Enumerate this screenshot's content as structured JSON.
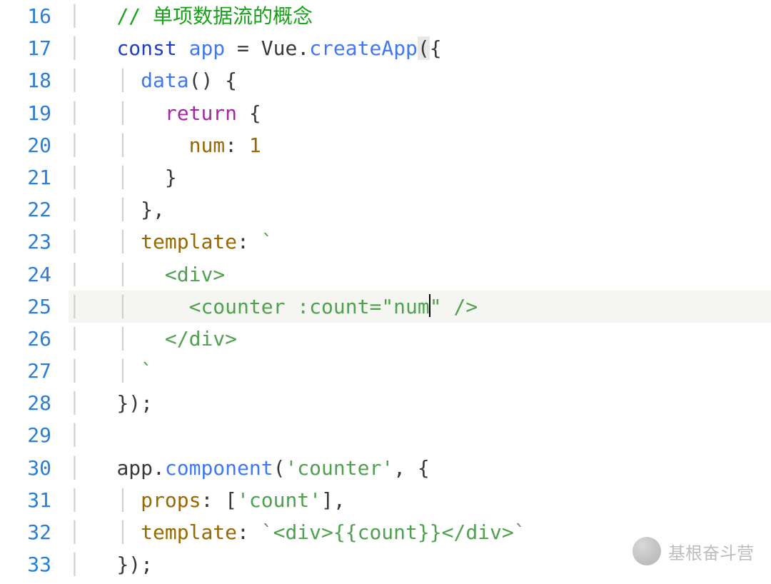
{
  "gutter": [
    "16",
    "17",
    "18",
    "19",
    "20",
    "21",
    "22",
    "23",
    "24",
    "25",
    "26",
    "27",
    "28",
    "29",
    "30",
    "31",
    "32",
    "33"
  ],
  "code": {
    "l16": {
      "comment": "// 单项数据流的概念"
    },
    "l17": {
      "kw": "const",
      "name": "app",
      "eq": " = ",
      "obj": "Vue",
      "dot": ".",
      "fn": "createApp",
      "open": "({"
    },
    "l18": {
      "fn": "data",
      "paren": "()",
      "brace": " {"
    },
    "l19": {
      "ret": "return",
      "brace": " {"
    },
    "l20": {
      "key": "num",
      "colon": ": ",
      "val": "1"
    },
    "l21": {
      "brace": "}"
    },
    "l22": {
      "brace": "},"
    },
    "l23": {
      "key": "template",
      "colon": ": ",
      "tick": "`"
    },
    "l24": {
      "txt": "<div>"
    },
    "l25": {
      "txt1": "<counter :count=\"num",
      "txt2": "\" />"
    },
    "l26": {
      "txt": "</div>"
    },
    "l27": {
      "tick": "`"
    },
    "l28": {
      "close": "});"
    },
    "l30": {
      "obj": "app",
      "dot": ".",
      "fn": "component",
      "open": "(",
      "str": "'counter'",
      "comma": ", {"
    },
    "l31": {
      "key": "props",
      "colon": ": ",
      "arr": "[",
      "str": "'count'",
      "arr2": "],"
    },
    "l32": {
      "key": "template",
      "colon": ": ",
      "tick1": "`",
      "txt": "<div>{{count}}</div>",
      "tick2": "`"
    },
    "l33": {
      "close": "});"
    }
  },
  "watermark": "基根奋斗营"
}
